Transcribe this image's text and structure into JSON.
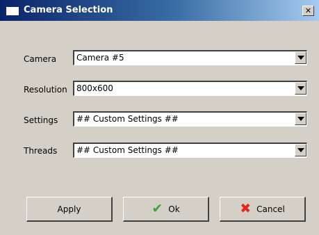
{
  "window": {
    "title": "Camera Selection",
    "close_glyph": "✕"
  },
  "fields": [
    {
      "label": "Camera",
      "value": "Camera #5"
    },
    {
      "label": "Resolution",
      "value": "800x600"
    },
    {
      "label": "Settings",
      "value": "## Custom Settings ##"
    },
    {
      "label": "Threads",
      "value": "## Custom Settings ##"
    }
  ],
  "buttons": {
    "apply": {
      "label": "Apply"
    },
    "ok": {
      "label": "Ok",
      "icon": "checkmark-icon",
      "glyph": "✔",
      "icon_color": "#3da43d"
    },
    "cancel": {
      "label": "Cancel",
      "icon": "red-x-icon",
      "glyph": "✖",
      "icon_color": "#e0281f"
    }
  },
  "colors": {
    "titlebar_start": "#0a246a",
    "titlebar_end": "#a6caf0",
    "dialog_background": "#d4d0c8"
  }
}
